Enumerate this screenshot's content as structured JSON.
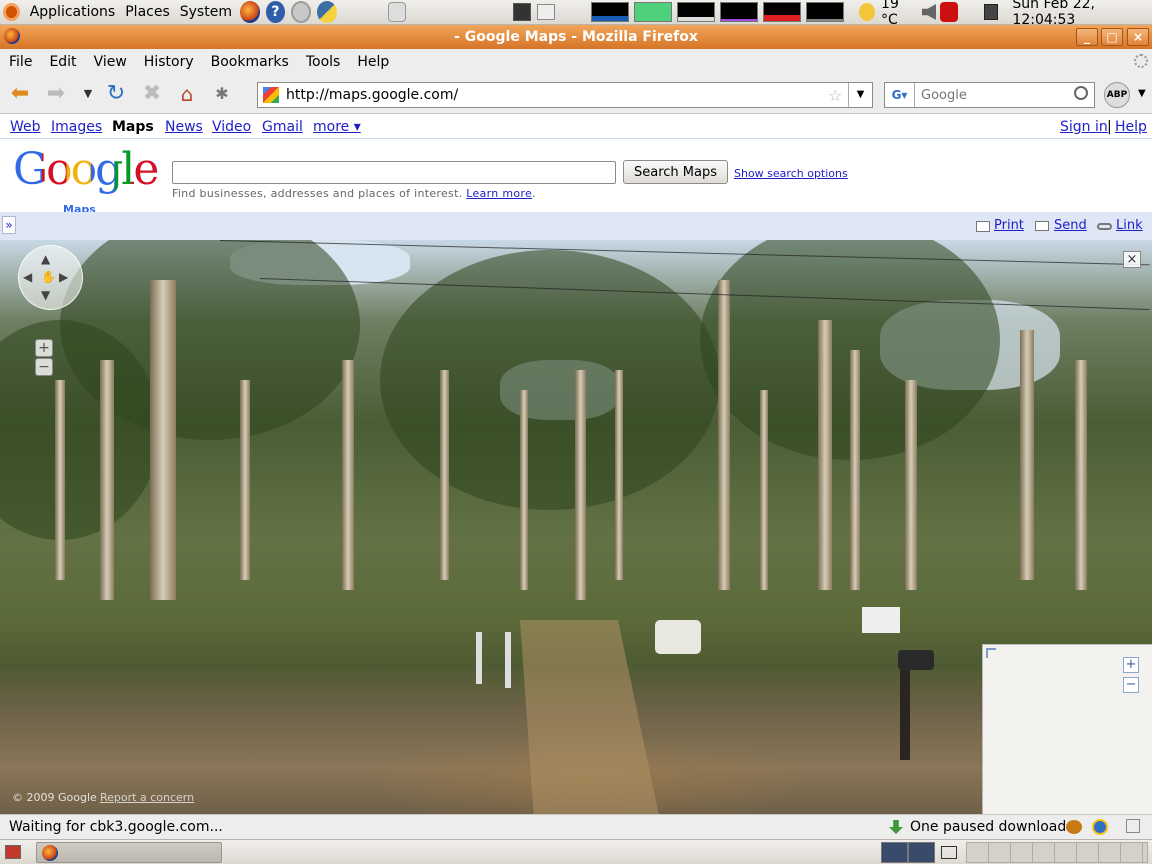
{
  "top_panel": {
    "menus": [
      "Applications",
      "Places",
      "System"
    ],
    "launchers": [
      "firefox-icon",
      "help-icon",
      "disk-icon",
      "python-icon"
    ],
    "weather": "19 °C",
    "clock": "Sun Feb 22, 12:04:53"
  },
  "window": {
    "title": "- Google Maps - Mozilla Firefox",
    "minimize_label": "_",
    "maximize_label": "□",
    "close_label": "×"
  },
  "menubar": {
    "items": [
      "File",
      "Edit",
      "View",
      "History",
      "Bookmarks",
      "Tools",
      "Help"
    ]
  },
  "navbar": {
    "url": "http://maps.google.com/",
    "search_placeholder": "Google",
    "abp_label": "ABP"
  },
  "gbar": {
    "links": [
      "Web",
      "Images"
    ],
    "current": "Maps",
    "links2": [
      "News",
      "Video",
      "Gmail"
    ],
    "more": "more ▾",
    "sign_in": "Sign in",
    "separator": "|",
    "help": "Help"
  },
  "maps": {
    "logo_text": "Google",
    "logo_sub": "Maps",
    "search_button": "Search Maps",
    "show_options": "Show search options",
    "hint_text": "Find businesses, addresses and places of interest.",
    "learn_more": "Learn more",
    "hint_end": ".",
    "print": "Print",
    "send": "Send",
    "link": "Link",
    "copyright": "© 2009 Google",
    "report": "Report a concern",
    "progress_marker": "»"
  },
  "statusbar": {
    "status": "Waiting for cbk3.google.com...",
    "download": "One paused download"
  },
  "colors": {
    "titlebar": "#e07b2c",
    "link": "#2020c8",
    "actionbar": "#dfe6f5"
  }
}
